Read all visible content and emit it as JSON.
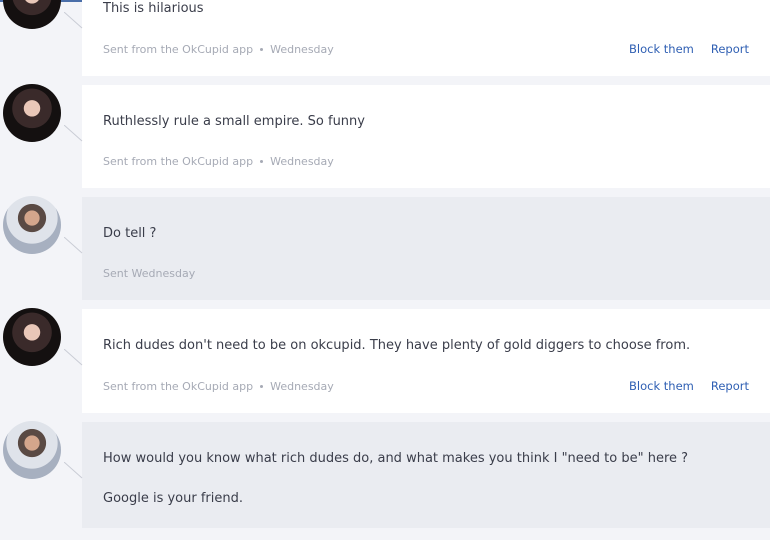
{
  "messages": [
    {
      "sender": "them",
      "text": [
        "This is hilarious"
      ],
      "via": "Sent from the OkCupid app",
      "day": "Wednesday",
      "block_label": "Block them",
      "report_label": "Report"
    },
    {
      "sender": "them",
      "text": [
        "Ruthlessly rule a small empire. So funny"
      ],
      "via": "Sent from the OkCupid app",
      "day": "Wednesday"
    },
    {
      "sender": "me",
      "text": [
        "Do tell ?"
      ],
      "sent_label": "Sent Wednesday"
    },
    {
      "sender": "them",
      "text": [
        "Rich dudes don't need to be on okcupid. They have plenty of gold diggers to choose from."
      ],
      "via": "Sent from the OkCupid app",
      "day": "Wednesday",
      "block_label": "Block them",
      "report_label": "Report"
    },
    {
      "sender": "me",
      "text": [
        "How would you know what rich dudes do, and what makes you think I \"need to be\" here ?",
        "Google is your friend."
      ]
    }
  ]
}
